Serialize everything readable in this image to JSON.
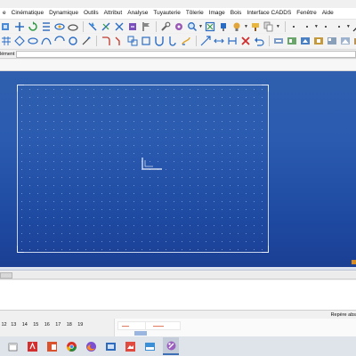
{
  "menu": [
    "e",
    "Cinématique",
    "Dynamique",
    "Outils",
    "Attribut",
    "Analyse",
    "Tuyauterie",
    "Tôlerie",
    "Image",
    "Bois",
    "Interface CADDS",
    "Fenêtre",
    "Aide"
  ],
  "propbar": {
    "label": "lément"
  },
  "status": {
    "right_text": "Repère abs"
  },
  "pages": [
    "12",
    "13",
    "14",
    "15",
    "16",
    "17",
    "18",
    "19"
  ],
  "colors": {
    "viewport_top": "#2f5fae",
    "viewport_bottom": "#1a3f93",
    "frame": "#e8eefc",
    "accent": "#3d6fb6"
  },
  "toolbar_icons": {
    "row1": [
      "zoom-fit-icon",
      "move-icon",
      "rotate-icon",
      "align-icon",
      "orbit-icon",
      "ellipse-icon",
      "hide-icon",
      "point-icon",
      "cross-icon",
      "pan-icon",
      "flag-icon",
      "wrench-icon",
      "attach-icon",
      "zoom-icon",
      "fit-window-icon",
      "lamp-icon",
      "light-icon",
      "paint-icon",
      "copy-icon",
      "line-style-icon",
      "pattern-icon"
    ],
    "row2": [
      "grid-icon",
      "diamond-icon",
      "oval-icon",
      "curve-icon",
      "arc-icon",
      "circle-icon",
      "sweep-icon",
      "bend-icon",
      "copy-shape-icon",
      "u-shape-icon",
      "box-icon",
      "hook-icon",
      "fillet-icon",
      "scale-icon",
      "stretch-icon",
      "coil-icon",
      "delete-icon",
      "layer-icon",
      "layer2-icon",
      "layer3-icon",
      "layer4-icon",
      "layer5-icon"
    ]
  },
  "taskbar": [
    "file-explorer-icon",
    "acrobat-icon",
    "office-icon",
    "chrome-icon",
    "firefox-icon",
    "app-icon",
    "photos-icon",
    "paint-app-icon",
    "cad-app-icon"
  ]
}
